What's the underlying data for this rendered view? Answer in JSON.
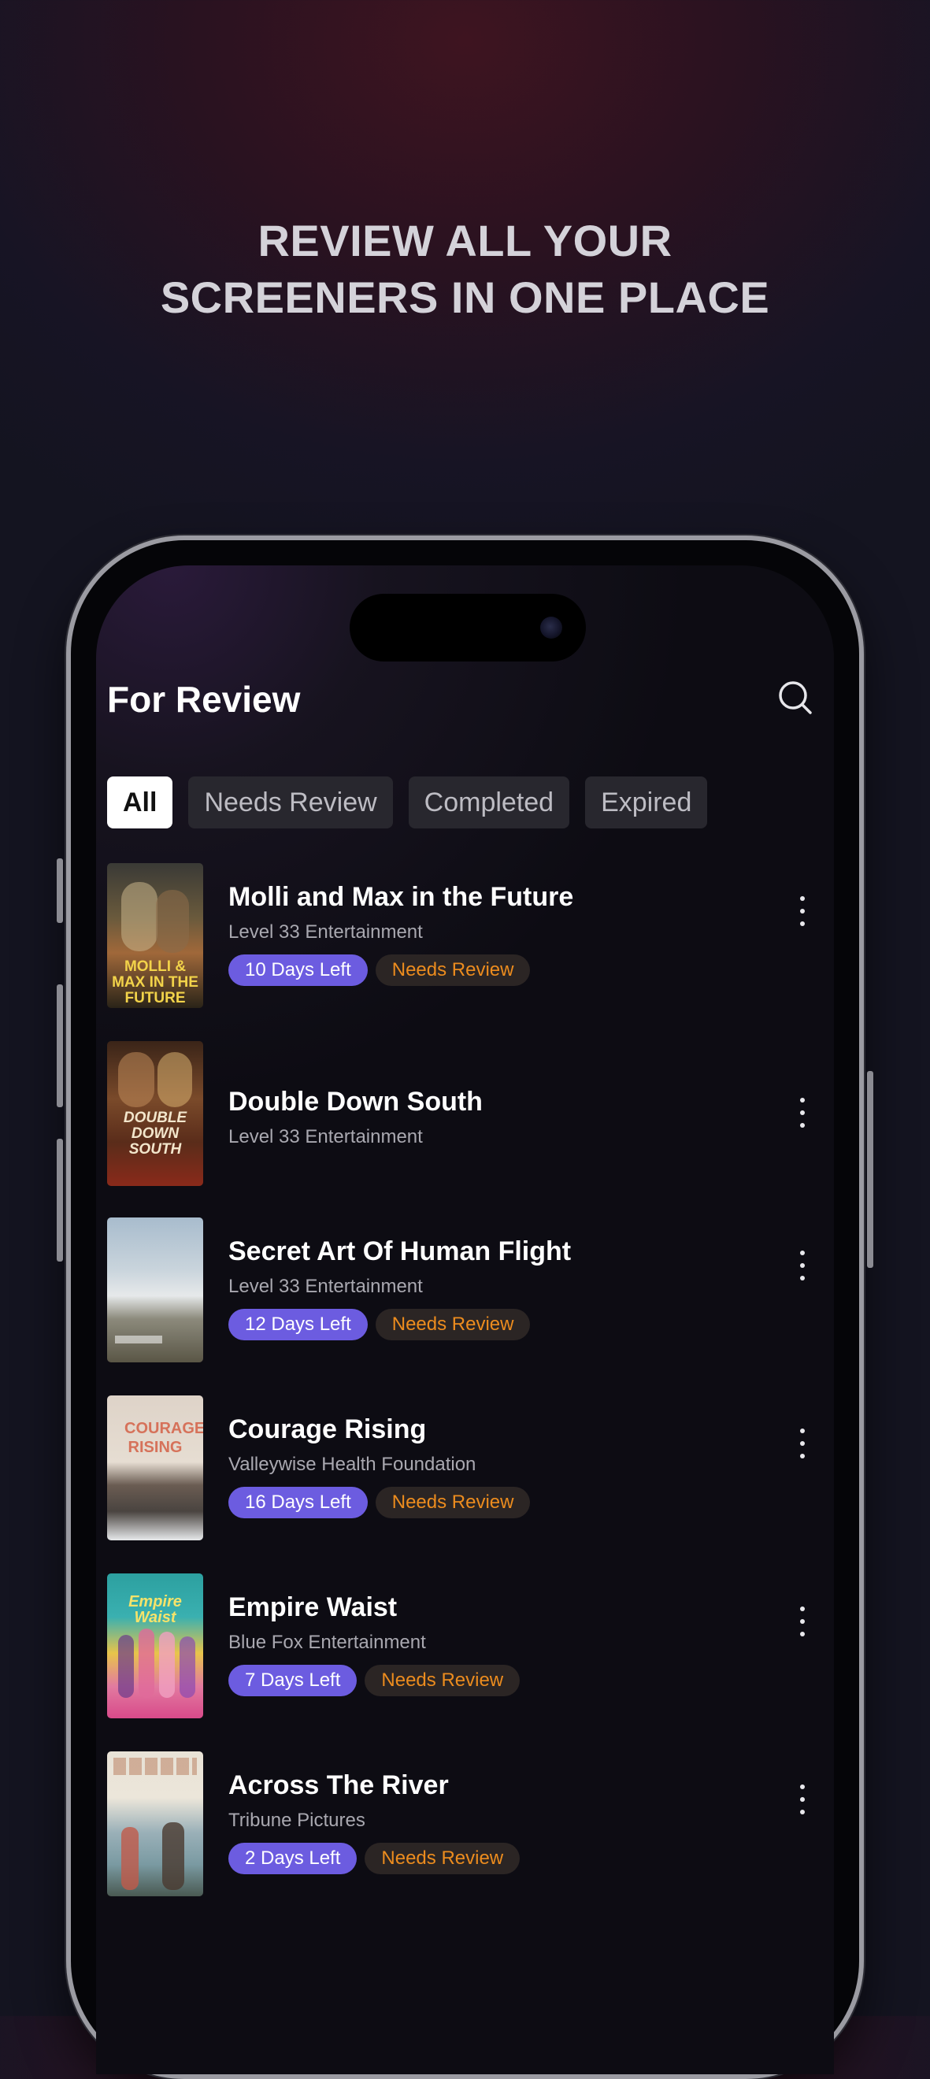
{
  "headline": {
    "line1": "REVIEW ALL YOUR",
    "line2": "SCREENERS IN ONE PLACE"
  },
  "screen": {
    "title": "For Review",
    "search_icon": "search-icon",
    "filters": [
      {
        "label": "All",
        "active": true
      },
      {
        "label": "Needs Review",
        "active": false
      },
      {
        "label": "Completed",
        "active": false
      },
      {
        "label": "Expired",
        "active": false
      }
    ],
    "items": [
      {
        "title": "Molli and Max in the Future",
        "studio": "Level 33 Entertainment",
        "days": "10 Days Left",
        "status": "Needs Review",
        "poster_text": "MOLLI & MAX IN THE FUTURE"
      },
      {
        "title": "Double Down South",
        "studio": "Level 33 Entertainment",
        "poster_text": "DOUBLE DOWN SOUTH"
      },
      {
        "title": "Secret Art Of Human Flight",
        "studio": "Level 33 Entertainment",
        "days": "12 Days Left",
        "status": "Needs Review"
      },
      {
        "title": "Courage Rising",
        "studio": "Valleywise Health Foundation",
        "days": "16 Days Left",
        "status": "Needs Review",
        "poster_text": "COURAGE RISING"
      },
      {
        "title": "Empire Waist",
        "studio": "Blue Fox Entertainment",
        "days": "7 Days Left",
        "status": "Needs Review",
        "poster_text": "Empire Waist"
      },
      {
        "title": "Across The River",
        "studio": "Tribune Pictures",
        "days": "2 Days Left",
        "status": "Needs Review"
      }
    ]
  },
  "colors": {
    "accent": "#6c5ce0",
    "status_text": "#ec8c1e"
  }
}
